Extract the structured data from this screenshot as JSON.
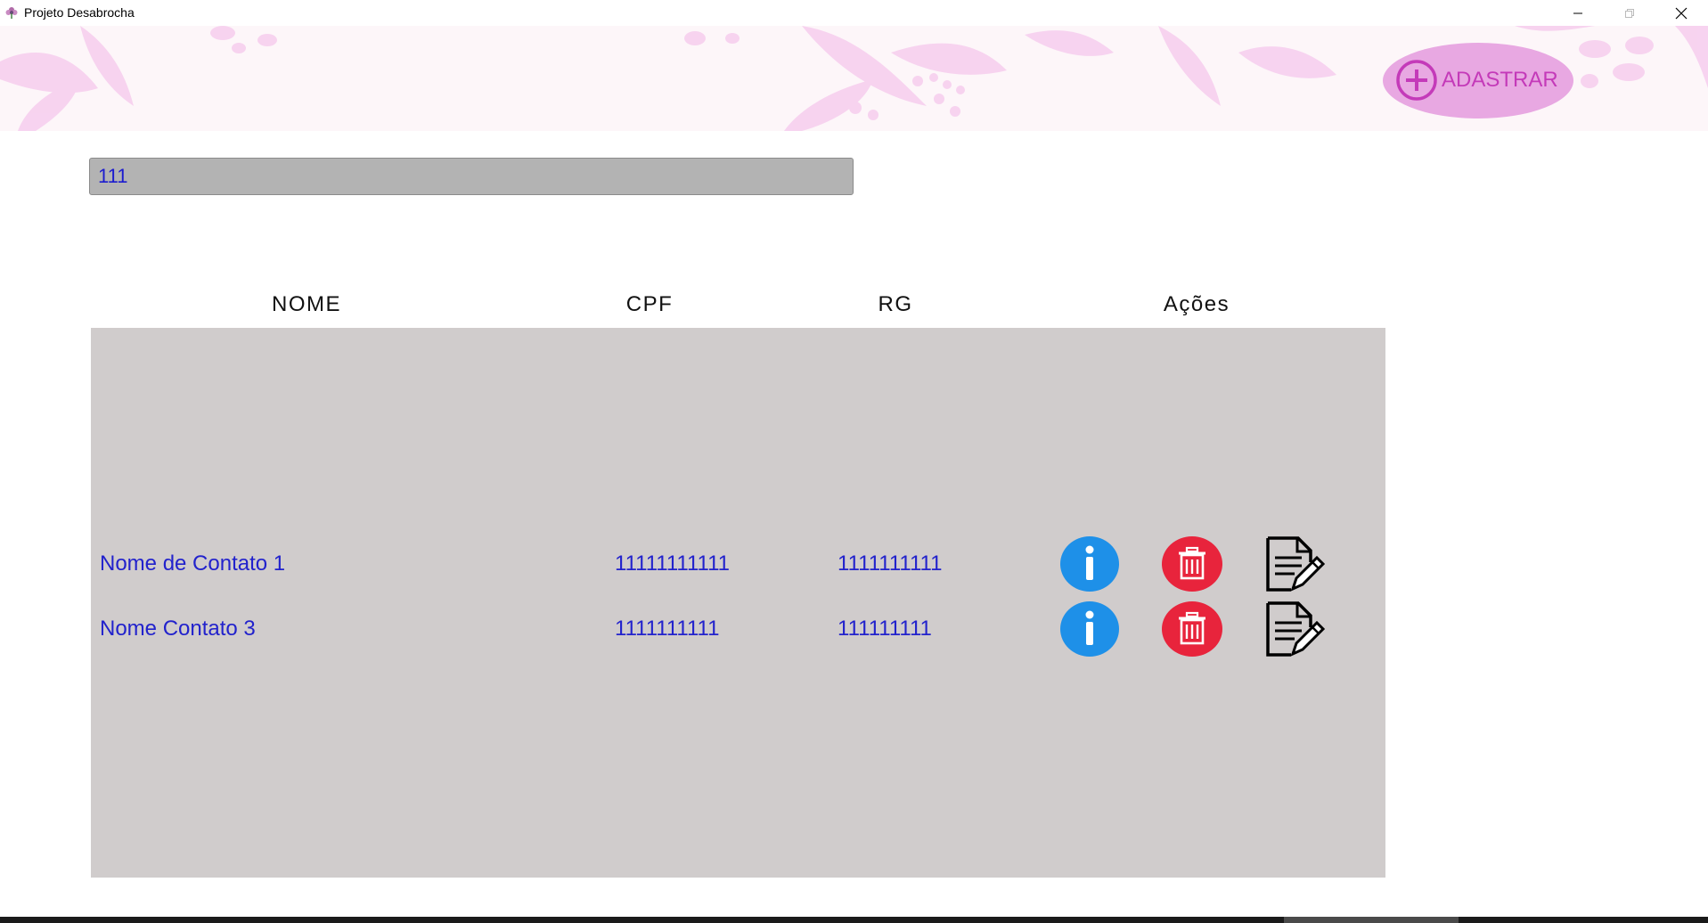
{
  "window": {
    "title": "Projeto Desabrocha"
  },
  "header": {
    "add_button_label": "ADASTRAR",
    "accent_color": "#e8a8e2",
    "accent_text_color": "#c43ab9"
  },
  "search": {
    "value": "111"
  },
  "table": {
    "columns": [
      "NOME",
      "CPF",
      "RG",
      "Ações"
    ],
    "rows": [
      {
        "nome": "Nome de Contato 1",
        "cpf": "11111111111",
        "rg": "1111111111"
      },
      {
        "nome": "Nome Contato 3",
        "cpf": "1111111111",
        "rg": "111111111"
      }
    ],
    "actions": [
      "info-icon",
      "trash-icon",
      "edit-document-icon"
    ],
    "colors": {
      "info": "#1e90e8",
      "delete": "#e8243c",
      "text": "#2222cc",
      "panel": "#d0cccc"
    }
  }
}
